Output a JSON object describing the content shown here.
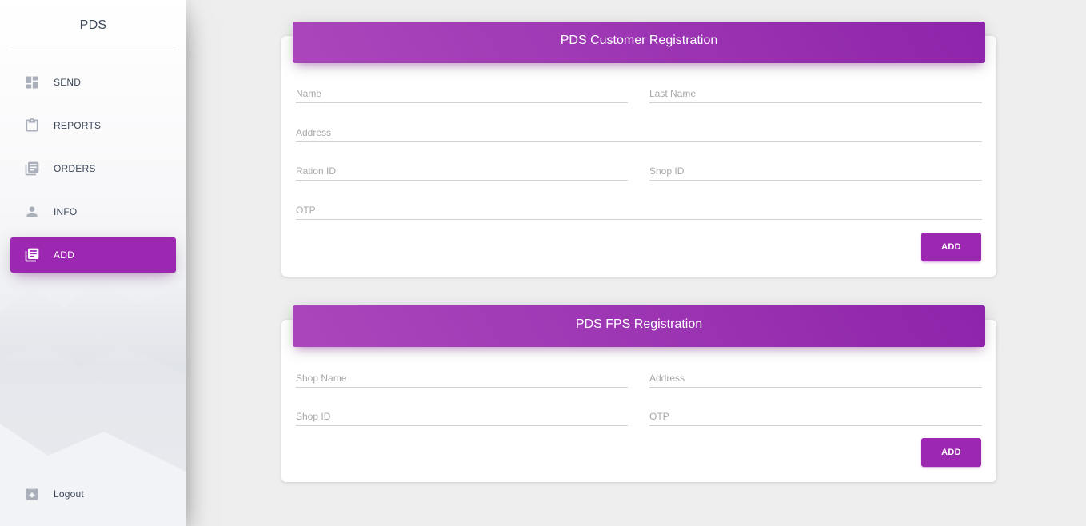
{
  "sidebar": {
    "brand": "PDS",
    "items": [
      {
        "label": "SEND",
        "icon": "dashboard-icon",
        "active": false
      },
      {
        "label": "REPORTS",
        "icon": "clipboard-icon",
        "active": false
      },
      {
        "label": "ORDERS",
        "icon": "library-books-icon",
        "active": false
      },
      {
        "label": "INFO",
        "icon": "person-icon",
        "active": false
      },
      {
        "label": "ADD",
        "icon": "library-books-icon",
        "active": true
      }
    ],
    "logout": {
      "label": "Logout",
      "icon": "unarchive-icon"
    }
  },
  "customer_form": {
    "title": "PDS Customer Registration",
    "fields": {
      "name": {
        "placeholder": "Name",
        "value": ""
      },
      "last_name": {
        "placeholder": "Last Name",
        "value": ""
      },
      "address": {
        "placeholder": "Address",
        "value": ""
      },
      "ration_id": {
        "placeholder": "Ration ID",
        "value": ""
      },
      "shop_id": {
        "placeholder": "Shop ID",
        "value": ""
      },
      "otp": {
        "placeholder": "OTP",
        "value": ""
      }
    },
    "submit_label": "ADD"
  },
  "fps_form": {
    "title": "PDS FPS Registration",
    "fields": {
      "shop_name": {
        "placeholder": "Shop Name",
        "value": ""
      },
      "address": {
        "placeholder": "Address",
        "value": ""
      },
      "shop_id": {
        "placeholder": "Shop ID",
        "value": ""
      },
      "otp": {
        "placeholder": "OTP",
        "value": ""
      }
    },
    "submit_label": "ADD"
  },
  "colors": {
    "accent": "#9c27b0",
    "header_gradient_start": "#ab47bc",
    "header_gradient_end": "#8e24aa",
    "background": "#eeeeee",
    "icon_gray": "#a9afbb"
  }
}
